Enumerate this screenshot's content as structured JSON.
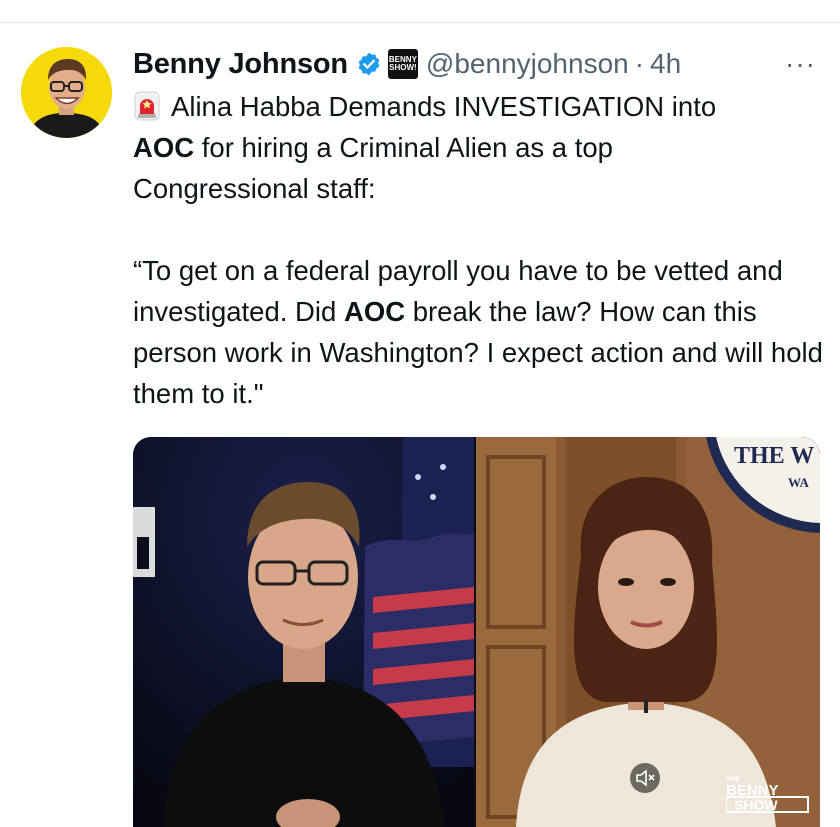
{
  "tweet": {
    "author_name": "Benny Johnson",
    "handle": "@bennyjohnson",
    "separator": "·",
    "time": "4h",
    "more_label": "···",
    "badge_line1": "BENNY",
    "badge_line2": "SHOW!",
    "text_segments": {
      "line1": "Alina Habba Demands INVESTIGATION into",
      "aoc1": "AOC",
      "line2_rest": " for hiring a Criminal Alien as a top",
      "line3": "Congressional staff:",
      "quote_a": "“To get on a federal payroll you have to be vetted and investigated. Did ",
      "aoc2": "AOC",
      "quote_b": " break the law? How can this person work in Washington? I expect action and will hold them to it.\""
    }
  },
  "media": {
    "seal_text_top": "THE W",
    "seal_text_sub": "WA",
    "watermark_line1": "THE",
    "watermark_line2": "BENNY",
    "watermark_line3": "SHOW"
  },
  "colors": {
    "verified_blue": "#1d9bf0",
    "secondary_text": "#536471",
    "avatar_bg": "#f5d90a"
  },
  "icons": [
    "verified-icon",
    "more-icon",
    "siren-icon",
    "mute-icon"
  ]
}
